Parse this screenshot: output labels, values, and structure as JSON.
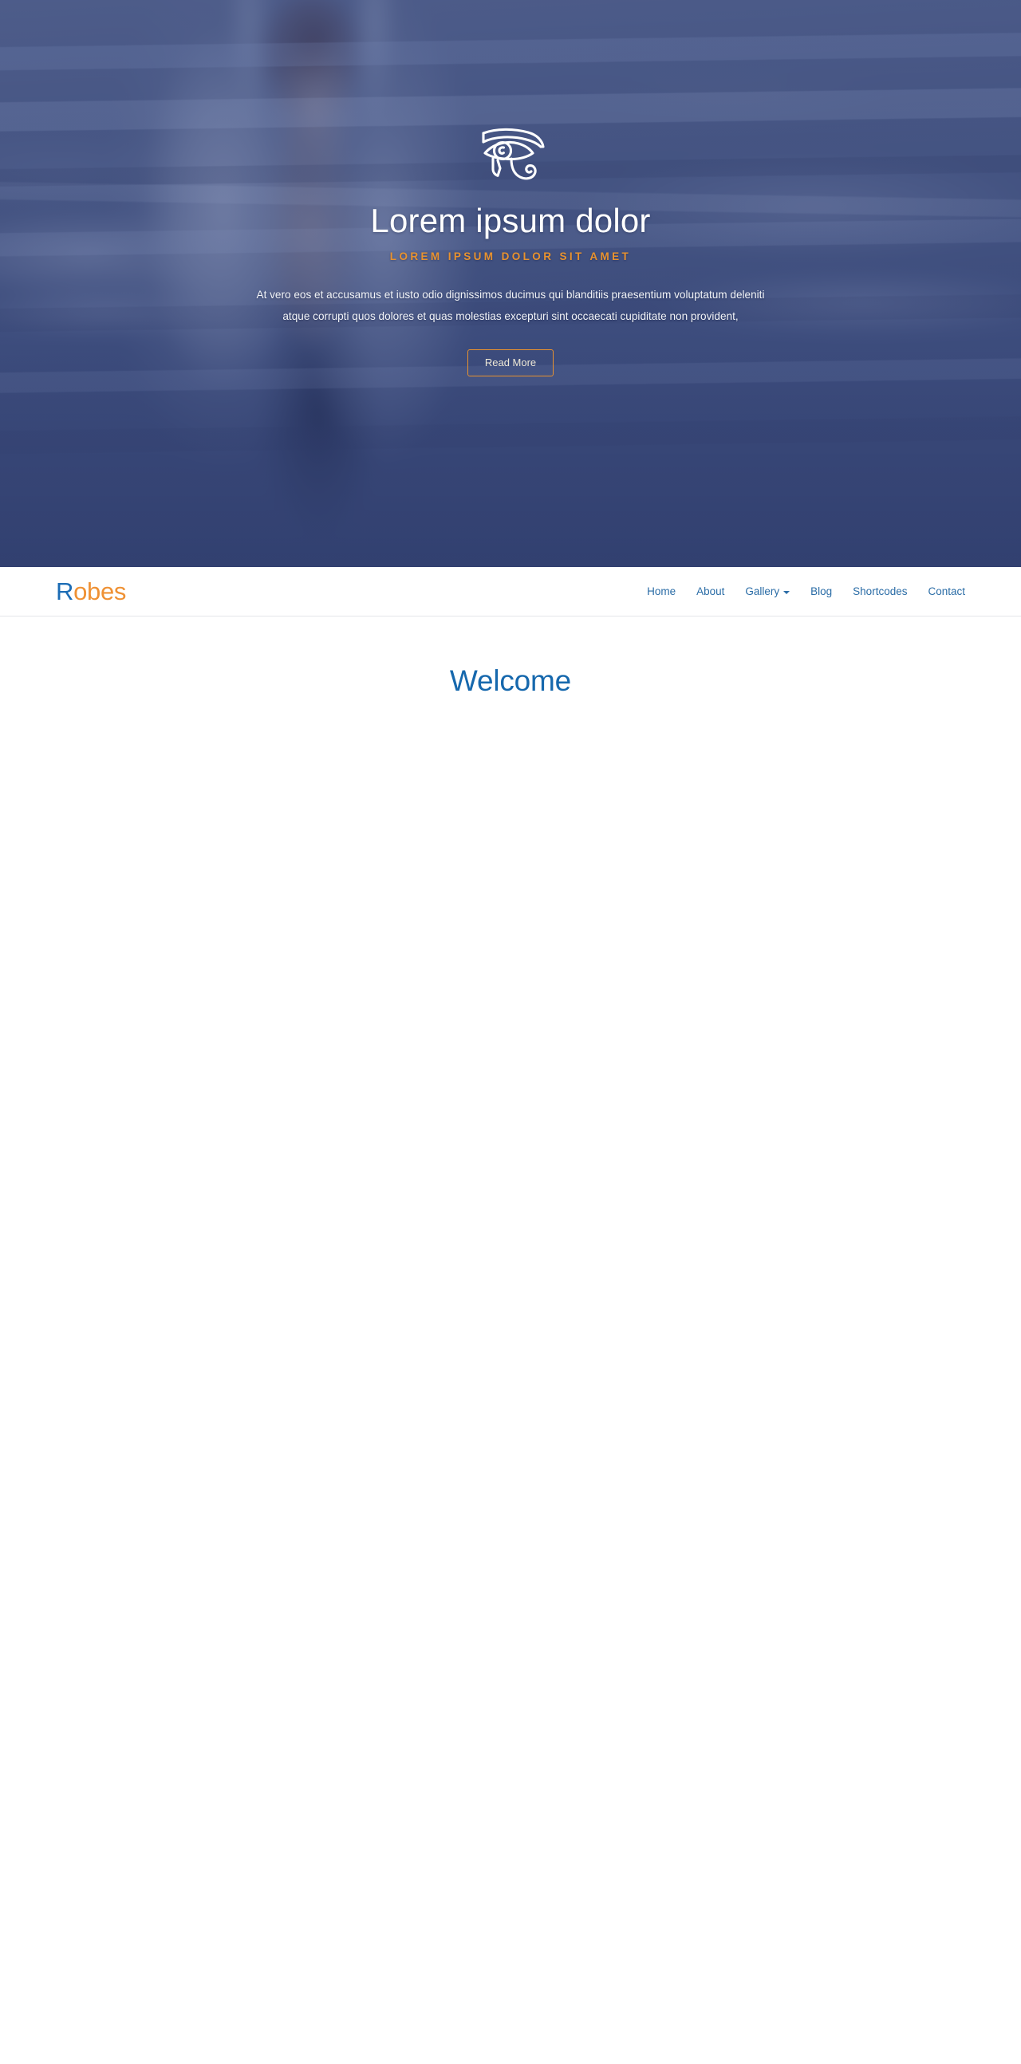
{
  "hero": {
    "icon": "eye-of-horus-icon",
    "title": "Lorem ipsum dolor",
    "subtitle": "LOREM IPSUM DOLOR SIT AMET",
    "paragraph": "At vero eos et accusamus et iusto odio dignissimos ducimus qui blanditiis praesentium voluptatum deleniti atque corrupti quos dolores et quas molestias excepturi sint occaecati cupiditate non provident,",
    "cta_label": "Read More",
    "title_color": "#ffffff",
    "subtitle_color": "#e8922f",
    "cta_border_color": "#e8922f",
    "overlay_color": "#2c3e7a"
  },
  "navbar": {
    "brand": {
      "initial": "R",
      "rest": "obes",
      "initial_color": "#1b6cb5",
      "rest_color": "#ef9134"
    },
    "link_color": "#2a6ca6",
    "items": [
      {
        "label": "Home",
        "name": "nav-link-home",
        "has_caret": false
      },
      {
        "label": "About",
        "name": "nav-link-about",
        "has_caret": false
      },
      {
        "label": "Gallery",
        "name": "nav-link-gallery",
        "has_caret": true
      },
      {
        "label": "Blog",
        "name": "nav-link-blog",
        "has_caret": false
      },
      {
        "label": "Shortcodes",
        "name": "nav-link-shortcodes",
        "has_caret": false
      },
      {
        "label": "Contact",
        "name": "nav-link-contact",
        "has_caret": false
      }
    ]
  },
  "main": {
    "welcome_heading": "Welcome",
    "welcome_color": "#1668ad"
  }
}
